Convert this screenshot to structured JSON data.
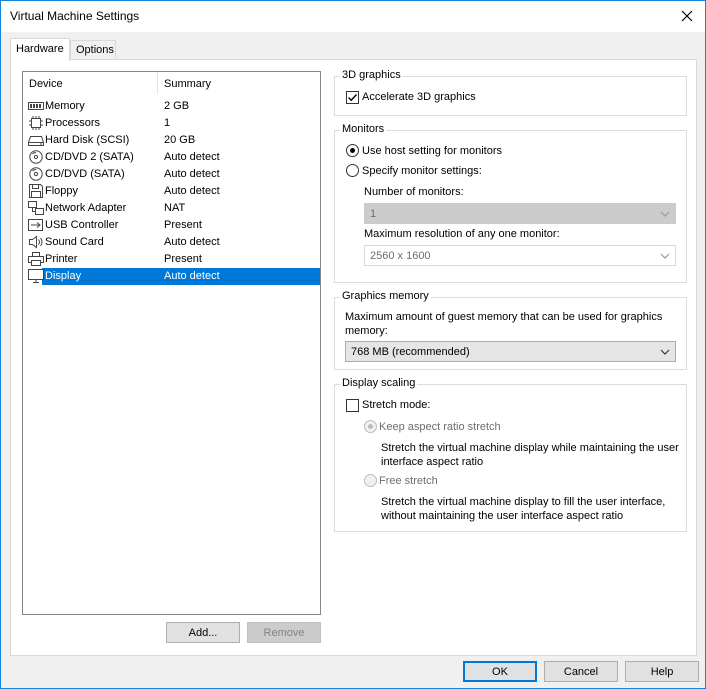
{
  "window": {
    "title": "Virtual Machine Settings"
  },
  "tabs": [
    {
      "label": "Hardware",
      "active": true
    },
    {
      "label": "Options",
      "active": false
    }
  ],
  "device_list": {
    "columns": [
      "Device",
      "Summary"
    ],
    "rows": [
      {
        "icon": "memory-icon",
        "name": "Memory",
        "summary": "2 GB"
      },
      {
        "icon": "processor-icon",
        "name": "Processors",
        "summary": "1"
      },
      {
        "icon": "hard-disk-icon",
        "name": "Hard Disk (SCSI)",
        "summary": "20 GB"
      },
      {
        "icon": "cd-dvd-icon",
        "name": "CD/DVD 2 (SATA)",
        "summary": "Auto detect"
      },
      {
        "icon": "cd-dvd-icon",
        "name": "CD/DVD (SATA)",
        "summary": "Auto detect"
      },
      {
        "icon": "floppy-icon",
        "name": "Floppy",
        "summary": "Auto detect"
      },
      {
        "icon": "network-adapter-icon",
        "name": "Network Adapter",
        "summary": "NAT"
      },
      {
        "icon": "usb-icon",
        "name": "USB Controller",
        "summary": "Present"
      },
      {
        "icon": "sound-card-icon",
        "name": "Sound Card",
        "summary": "Auto detect"
      },
      {
        "icon": "printer-icon",
        "name": "Printer",
        "summary": "Present"
      },
      {
        "icon": "display-icon",
        "name": "Display",
        "summary": "Auto detect",
        "selected": true
      }
    ],
    "add_label": "Add...",
    "remove_label": "Remove"
  },
  "graphics3d": {
    "title": "3D graphics",
    "accelerate_label": "Accelerate 3D graphics",
    "accelerate_checked": true
  },
  "monitors": {
    "title": "Monitors",
    "use_host_label": "Use host setting for monitors",
    "specify_label": "Specify monitor settings:",
    "selected": "use_host",
    "num_monitors_label": "Number of monitors:",
    "num_monitors_value": "1",
    "max_res_label": "Maximum resolution of any one monitor:",
    "max_res_value": "2560 x 1600"
  },
  "graphics_memory": {
    "title": "Graphics memory",
    "description": "Maximum amount of guest memory that can be used for graphics memory:",
    "value": "768 MB (recommended)"
  },
  "display_scaling": {
    "title": "Display scaling",
    "stretch_label": "Stretch mode:",
    "stretch_checked": false,
    "keep_aspect_label": "Keep aspect ratio stretch",
    "keep_aspect_desc": "Stretch the virtual machine display while maintaining the user interface aspect ratio",
    "free_stretch_label": "Free stretch",
    "free_stretch_desc": "Stretch the virtual machine display to fill the user interface, without maintaining the user interface aspect ratio"
  },
  "footer": {
    "ok_label": "OK",
    "cancel_label": "Cancel",
    "help_label": "Help"
  },
  "colors": {
    "selection": "#0078d7",
    "window_border": "#1883d7",
    "dialog_bg": "#f0f0f0"
  }
}
